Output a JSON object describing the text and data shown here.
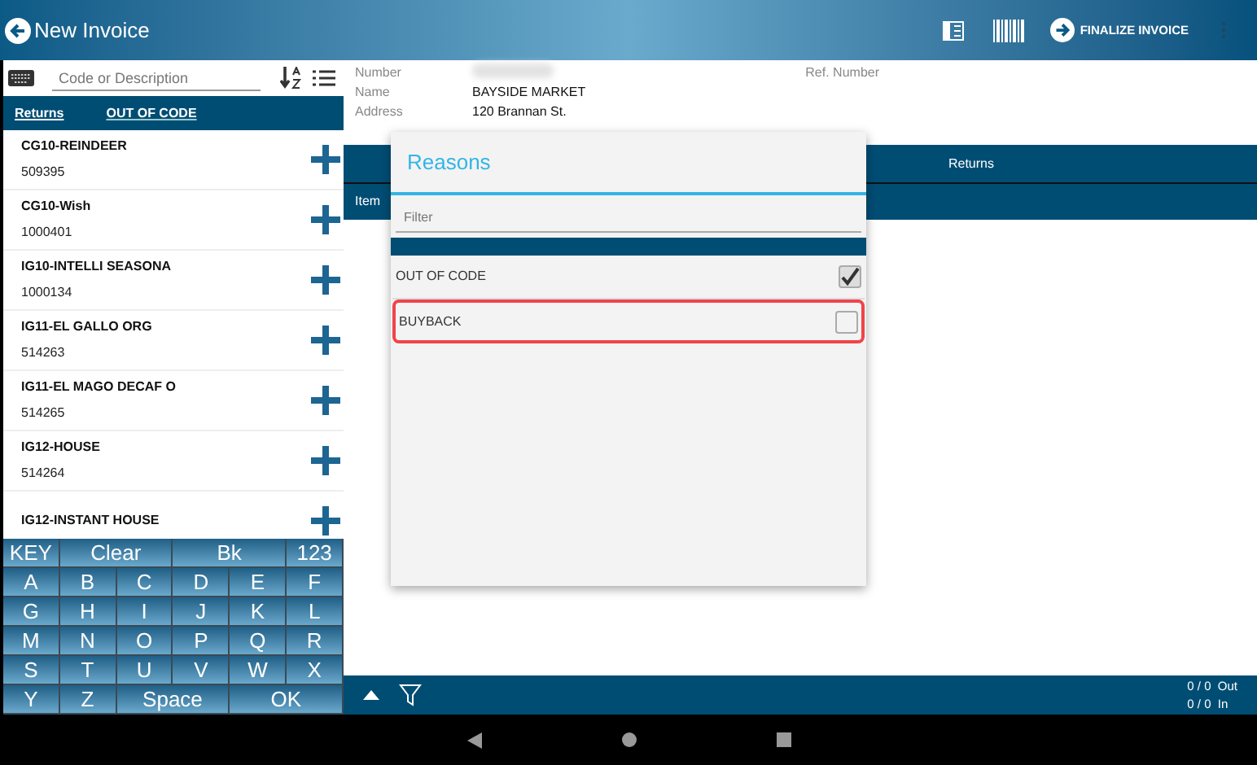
{
  "app_bar": {
    "title": "New Invoice",
    "finalize": "FINALIZE INVOICE"
  },
  "search": {
    "placeholder": "Code or Description"
  },
  "left_tabs": [
    {
      "label": "Returns",
      "selected": true
    },
    {
      "label": "OUT OF CODE",
      "selected": false
    }
  ],
  "products": [
    {
      "name": "CG10-REINDEER",
      "code": "509395"
    },
    {
      "name": "CG10-Wish",
      "code": "1000401"
    },
    {
      "name": "IG10-INTELLI SEASONA",
      "code": "1000134"
    },
    {
      "name": "IG11-EL GALLO ORG",
      "code": "514263"
    },
    {
      "name": "IG11-EL MAGO DECAF O",
      "code": "514265"
    },
    {
      "name": "IG12-HOUSE",
      "code": "514264"
    },
    {
      "name": "IG12-INSTANT HOUSE"
    }
  ],
  "keyboard": [
    [
      {
        "label": "KEY",
        "kind": "key"
      },
      {
        "label": "Clear",
        "kind": "wide"
      },
      {
        "label": "Bk",
        "kind": "wide"
      },
      {
        "label": "123",
        "kind": "key"
      }
    ],
    [
      {
        "label": "A",
        "kind": "key"
      },
      {
        "label": "B",
        "kind": "key"
      },
      {
        "label": "C",
        "kind": "key"
      },
      {
        "label": "D",
        "kind": "key"
      },
      {
        "label": "E",
        "kind": "key"
      },
      {
        "label": "F",
        "kind": "key"
      }
    ],
    [
      {
        "label": "G",
        "kind": "key"
      },
      {
        "label": "H",
        "kind": "key"
      },
      {
        "label": "I",
        "kind": "key"
      },
      {
        "label": "J",
        "kind": "key"
      },
      {
        "label": "K",
        "kind": "key"
      },
      {
        "label": "L",
        "kind": "key"
      }
    ],
    [
      {
        "label": "M",
        "kind": "key"
      },
      {
        "label": "N",
        "kind": "key"
      },
      {
        "label": "O",
        "kind": "key"
      },
      {
        "label": "P",
        "kind": "key"
      },
      {
        "label": "Q",
        "kind": "key"
      },
      {
        "label": "R",
        "kind": "key"
      }
    ],
    [
      {
        "label": "S",
        "kind": "key"
      },
      {
        "label": "T",
        "kind": "key"
      },
      {
        "label": "U",
        "kind": "key"
      },
      {
        "label": "V",
        "kind": "key"
      },
      {
        "label": "W",
        "kind": "key"
      },
      {
        "label": "X",
        "kind": "key"
      }
    ],
    [
      {
        "label": "Y",
        "kind": "key"
      },
      {
        "label": "Z",
        "kind": "key"
      },
      {
        "label": "Space",
        "kind": "wide"
      },
      {
        "label": "OK",
        "kind": "wide"
      }
    ]
  ],
  "customer": [
    {
      "label": "Number"
    },
    {
      "label": "Name",
      "value": "BAYSIDE MARKET"
    },
    {
      "label": "Address",
      "value": "120 Brannan St."
    }
  ],
  "ref_number": {
    "label": "Ref. Number"
  },
  "table": {
    "band": "Returns",
    "columns": [
      "Item"
    ]
  },
  "dialog": {
    "title": "Reasons",
    "filter_placeholder": "Filter",
    "options": [
      {
        "label": "OUT OF CODE",
        "checked": true,
        "highlighted": false
      },
      {
        "label": "BUYBACK",
        "checked": false,
        "highlighted": true
      }
    ]
  },
  "footer": {
    "out": "0 / 0  Out",
    "in": "0 / 0  In"
  }
}
